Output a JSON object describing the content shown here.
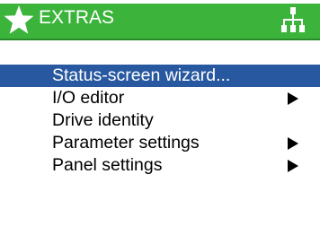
{
  "colors": {
    "header_background": "#3cb43c",
    "header_border": "#2a8a2a",
    "header_text": "#ffffff",
    "selection_background": "#2859a0",
    "text": "#000000",
    "background": "#ffffff"
  },
  "header": {
    "title": "EXTRAS",
    "left_icon": "star-icon",
    "right_icon": "menu-tree-icon"
  },
  "menu": {
    "items": [
      {
        "label": "Status-screen wizard...",
        "selected": true,
        "has_submenu": false
      },
      {
        "label": "I/O editor",
        "selected": false,
        "has_submenu": true
      },
      {
        "label": "Drive identity",
        "selected": false,
        "has_submenu": false
      },
      {
        "label": "Parameter settings",
        "selected": false,
        "has_submenu": true
      },
      {
        "label": "Panel settings",
        "selected": false,
        "has_submenu": true
      }
    ],
    "submenu_icon": "triangle-right-icon"
  }
}
